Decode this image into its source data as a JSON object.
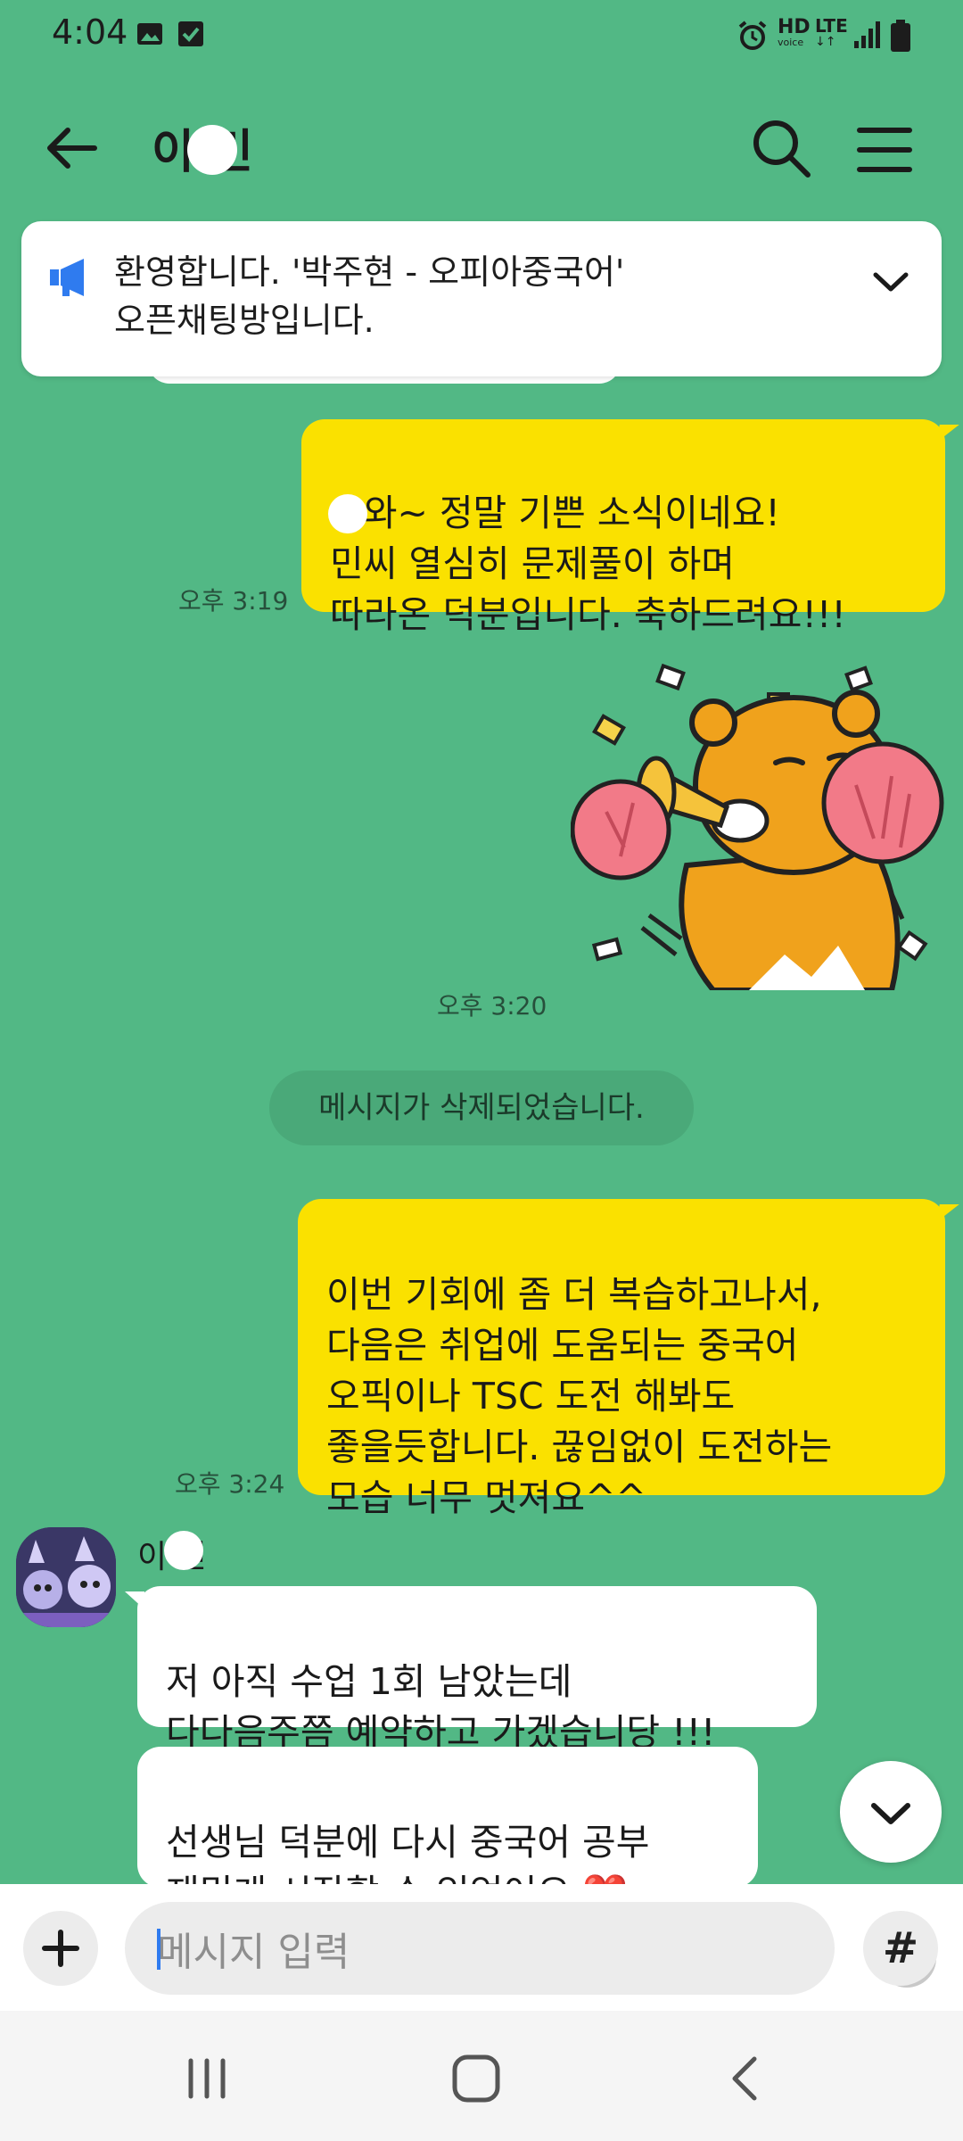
{
  "status_bar": {
    "time": "4:04",
    "icons": [
      "gallery-icon",
      "checkbox-icon",
      "alarm-icon",
      "hd-voice-icon",
      "lte-icon",
      "signal-icon",
      "battery-icon"
    ],
    "hd_label": "HD",
    "voice_label": "voice",
    "lte_label": "LTE"
  },
  "header": {
    "title": "이 민"
  },
  "notice": {
    "text": "환영합니다. '박주현 - 오피아중국어'\n오픈채팅방입니다."
  },
  "messages": [
    {
      "from": "me",
      "text": "우와~ 정말 기쁜 소식이네요!\n  민씨 열심히 문제풀이 하며\n따라온 덕분입니다. 축하드려요!!!",
      "time": "오후 3:19"
    },
    {
      "from": "me",
      "type": "sticker",
      "time": "오후 3:20"
    },
    {
      "type": "system",
      "text": "메시지가 삭제되었습니다."
    },
    {
      "from": "me",
      "text": "이번 기회에 좀 더 복습하고나서,\n다음은 취업에 도움되는 중국어\n오픽이나 TSC 도전 해봐도\n좋을듯합니다. 끊임없이 도전하는\n모습 너무 멋져요^^",
      "time": "오후 3:24"
    },
    {
      "from": "other",
      "sender": "이 민",
      "text": "저 아직 수업 1회 남았는데\n다다음주쯤 예약하고 가겠습니당 !!!"
    },
    {
      "from": "other",
      "text": "선생님 덕분에 다시 중국어 공부\n재밌게 시작할 수 있었어요 ❤️"
    }
  ],
  "input": {
    "placeholder": "메시지 입력",
    "hash_label": "#"
  },
  "colors": {
    "chat_bg": "#52b885",
    "my_bubble": "#fae100",
    "other_bubble": "#ffffff",
    "notice_icon": "#2f7bef"
  }
}
